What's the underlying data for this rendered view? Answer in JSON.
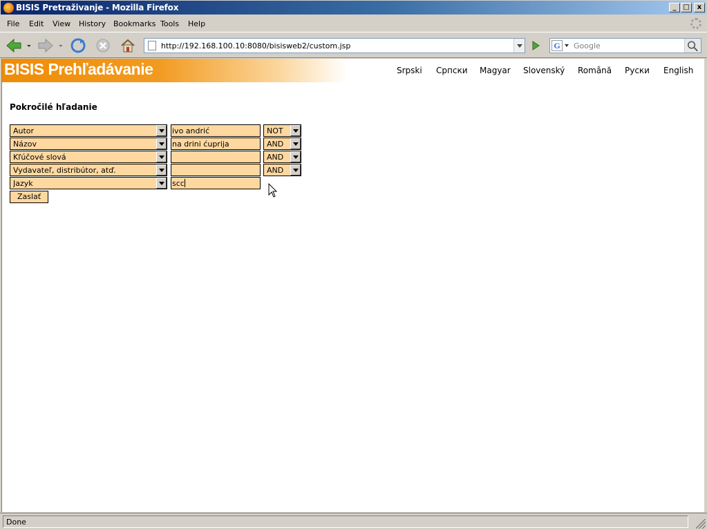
{
  "window": {
    "title": "BISIS Pretraživanje - Mozilla Firefox",
    "minimize": "_",
    "maximize": "□",
    "close": "x"
  },
  "menu": [
    "File",
    "Edit",
    "View",
    "History",
    "Bookmarks",
    "Tools",
    "Help"
  ],
  "toolbar": {
    "url": "http://192.168.100.10:8080/bisisweb2/custom.jsp",
    "search_placeholder": "Google",
    "search_engine_letter": "G"
  },
  "banner": {
    "brand": "BISIS Prehľadávanie",
    "languages": [
      "Srpski",
      "Српски",
      "Magyar",
      "Slovenský",
      "Română",
      "Руски",
      "English"
    ]
  },
  "form": {
    "heading": "Pokročilé hľadanie",
    "rows": [
      {
        "field": "Autor",
        "value": "ivo andrić",
        "operator": "NOT"
      },
      {
        "field": "Názov",
        "value": "na drini ćuprija",
        "operator": "AND"
      },
      {
        "field": "Kľúčové slová",
        "value": "",
        "operator": "AND"
      },
      {
        "field": "Vydavateľ, distribútor, atď.",
        "value": "",
        "operator": "AND"
      },
      {
        "field": "Jazyk",
        "value": "scc",
        "operator": null
      }
    ],
    "submit_label": "Zaslať"
  },
  "status": {
    "text": "Done"
  },
  "colors": {
    "field_bg": "#ffd8a0",
    "brand_orange": "#ef8c06",
    "title_bar": "#0a246a"
  }
}
